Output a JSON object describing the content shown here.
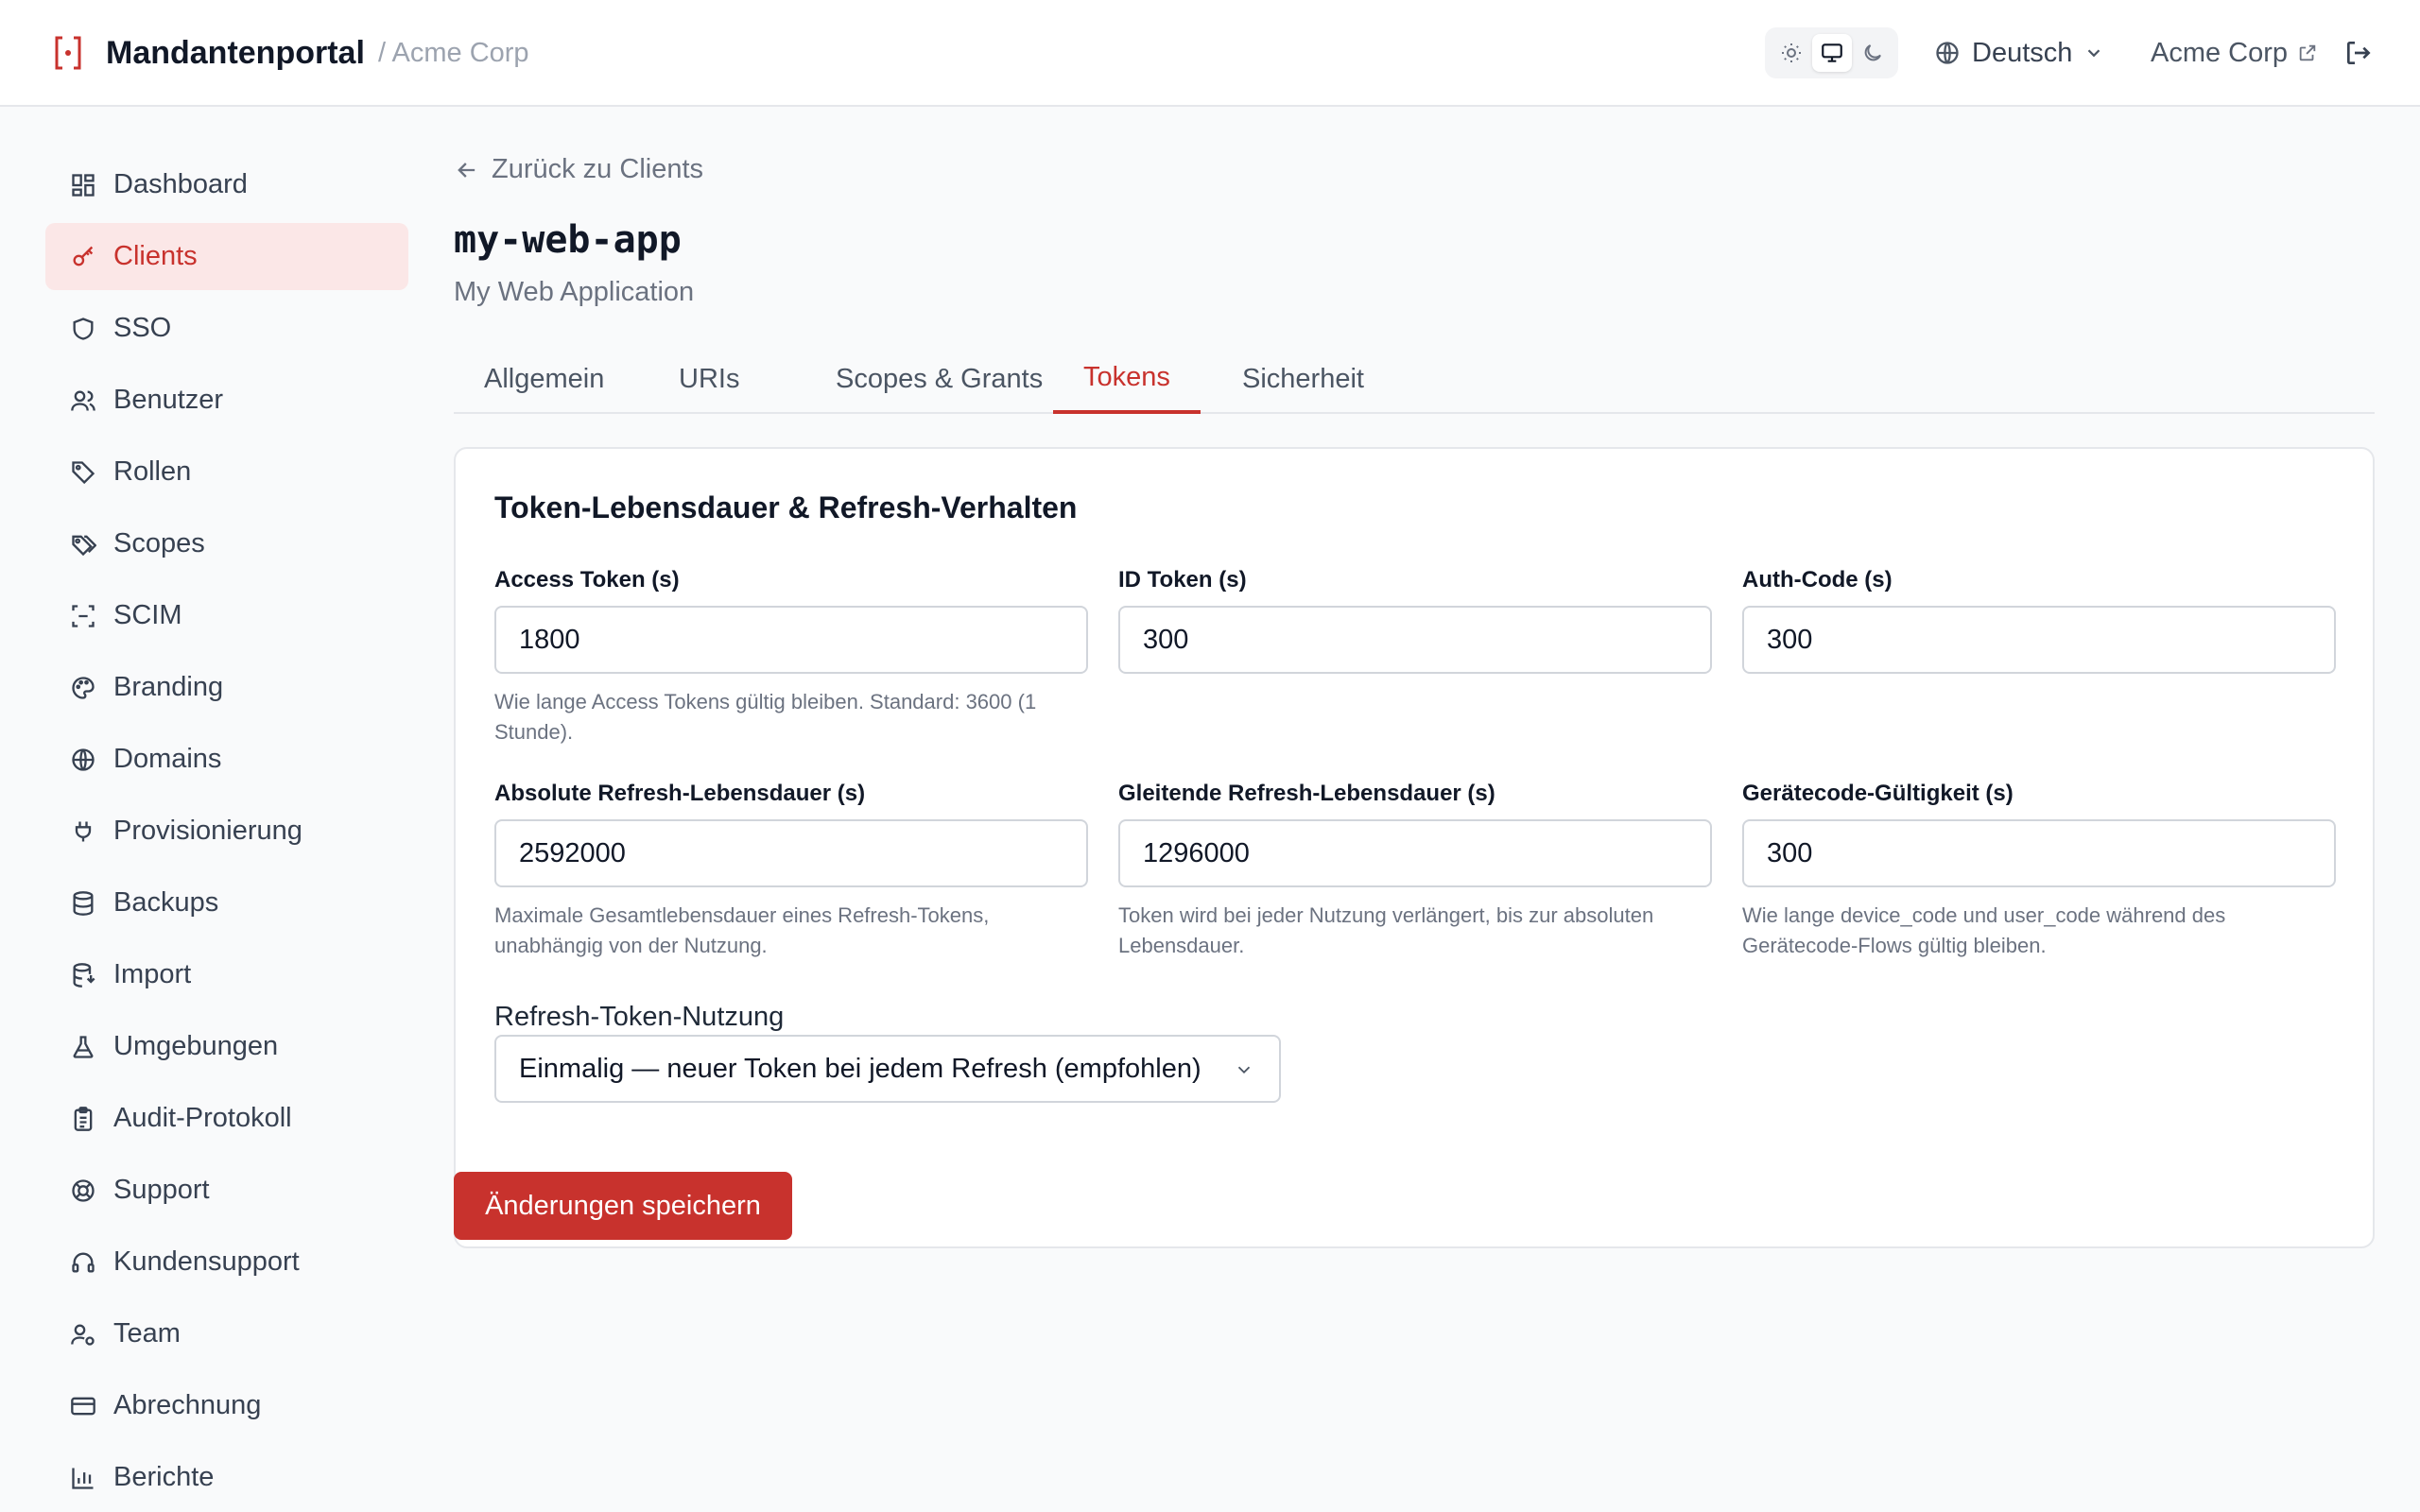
{
  "header": {
    "app_title": "Mandantenportal",
    "breadcrumb_tenant": "/ Acme Corp",
    "language": "Deutsch",
    "tenant_link": "Acme Corp",
    "theme_options": [
      "light",
      "system",
      "dark"
    ],
    "theme_selected": "system"
  },
  "sidebar": {
    "items": [
      {
        "label": "Dashboard",
        "icon": "dashboard-icon"
      },
      {
        "label": "Clients",
        "icon": "key-icon",
        "active": true
      },
      {
        "label": "SSO",
        "icon": "shield-icon"
      },
      {
        "label": "Benutzer",
        "icon": "users-icon"
      },
      {
        "label": "Rollen",
        "icon": "tag-icon"
      },
      {
        "label": "Scopes",
        "icon": "tags-icon"
      },
      {
        "label": "SCIM",
        "icon": "scan-icon"
      },
      {
        "label": "Branding",
        "icon": "palette-icon"
      },
      {
        "label": "Domains",
        "icon": "globe-icon"
      },
      {
        "label": "Provisionierung",
        "icon": "plug-icon"
      },
      {
        "label": "Backups",
        "icon": "database-icon"
      },
      {
        "label": "Import",
        "icon": "database-import-icon"
      },
      {
        "label": "Umgebungen",
        "icon": "flask-icon"
      },
      {
        "label": "Audit-Protokoll",
        "icon": "clipboard-icon"
      },
      {
        "label": "Support",
        "icon": "lifebuoy-icon"
      },
      {
        "label": "Kundensupport",
        "icon": "headset-icon"
      },
      {
        "label": "Team",
        "icon": "user-cog-icon"
      },
      {
        "label": "Abrechnung",
        "icon": "credit-card-icon"
      },
      {
        "label": "Berichte",
        "icon": "bar-chart-icon"
      }
    ]
  },
  "main": {
    "back_label": "Zurück zu Clients",
    "client_id": "my-web-app",
    "client_name": "My Web Application",
    "tabs": [
      {
        "label": "Allgemein"
      },
      {
        "label": "URIs"
      },
      {
        "label": "Scopes & Grants"
      },
      {
        "label": "Tokens",
        "active": true
      },
      {
        "label": "Sicherheit"
      }
    ],
    "card": {
      "title": "Token-Lebensdauer & Refresh-Verhalten",
      "fields": [
        {
          "label": "Access Token (s)",
          "value": "1800",
          "hint": "Wie lange Access Tokens gültig bleiben. Standard: 3600 (1 Stunde)."
        },
        {
          "label": "ID Token (s)",
          "value": "300",
          "hint": ""
        },
        {
          "label": "Auth-Code (s)",
          "value": "300",
          "hint": ""
        },
        {
          "label": "Absolute Refresh-Lebensdauer (s)",
          "value": "2592000",
          "hint": "Maximale Gesamtlebensdauer eines Refresh-Tokens, unabhängig von der Nutzung."
        },
        {
          "label": "Gleitende Refresh-Lebensdauer (s)",
          "value": "1296000",
          "hint": "Token wird bei jeder Nutzung verlängert, bis zur absoluten Lebensdauer."
        },
        {
          "label": "Gerätecode-Gültigkeit (s)",
          "value": "300",
          "hint": "Wie lange device_code und user_code während des Gerätecode-Flows gültig bleiben."
        }
      ],
      "refresh_usage_label": "Refresh-Token-Nutzung",
      "refresh_usage_value": "Einmalig — neuer Token bei jedem Refresh (empfohlen)"
    },
    "save_label": "Änderungen speichern"
  },
  "colors": {
    "accent": "#c8322d",
    "active_bg": "#fbe7e7",
    "page_bg": "#f9fafb"
  }
}
